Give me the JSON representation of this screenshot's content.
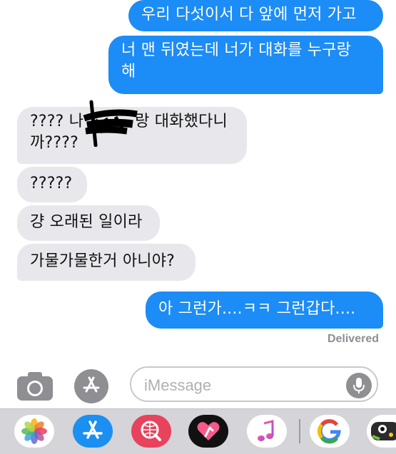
{
  "messages": [
    {
      "direction": "outgoing",
      "text": "우리 다섯이서 다 앞에 먼저 가고"
    },
    {
      "direction": "outgoing",
      "text": "너 맨 뒤였는데 너가 대화를 누구랑\n해"
    },
    {
      "direction": "incoming",
      "text": "???? 나          랑 대화했다니\n까????",
      "redacted": true
    },
    {
      "direction": "incoming",
      "text": "?????"
    },
    {
      "direction": "incoming",
      "text": "걍 오래된 일이라"
    },
    {
      "direction": "incoming",
      "text": "가물가물한거 아니야?"
    },
    {
      "direction": "outgoing",
      "text": "아 그런가....ㅋㅋ 그런갑다...."
    }
  ],
  "status": {
    "delivered": "Delivered"
  },
  "composer": {
    "placeholder": "iMessage",
    "camera_icon": "camera-icon",
    "apps_icon": "app-store-icon",
    "mic_icon": "microphone-icon"
  },
  "app_drawer": {
    "apps": [
      {
        "name": "Photos",
        "icon": "photos-icon"
      },
      {
        "name": "App Store",
        "icon": "app-store-icon"
      },
      {
        "name": "Web Search",
        "icon": "web-search-icon"
      },
      {
        "name": "Digital Touch",
        "icon": "heart-touch-icon"
      },
      {
        "name": "Music",
        "icon": "music-icon"
      },
      {
        "name": "Google",
        "icon": "google-icon"
      },
      {
        "name": "Game",
        "icon": "game-icon"
      }
    ]
  },
  "colors": {
    "outgoing": "#1c8cf6",
    "incoming": "#e8e8ec",
    "drawer": "#d4d4d9"
  }
}
